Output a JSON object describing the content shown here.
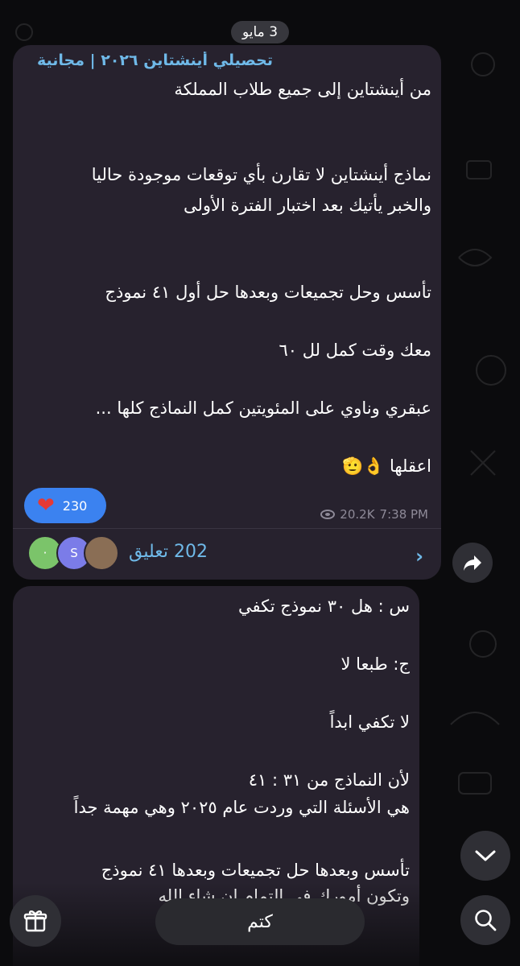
{
  "date_separator": "3 مايو",
  "post": {
    "channel": "تحصيلي أينشتاين ٢٠٢٦ | مجانية",
    "lines": [
      "من أينشتاين إلى جميع طلاب المملكة",
      "نماذج أينشتاين لا تقارن بأي توقعات موجودة حاليا",
      "والخبر يأتيك بعد اختبار الفترة الأولى",
      "تأسس وحل تجميعات وبعدها حل أول ٤١ نموذج",
      "معك وقت كمل لل ٦٠",
      "عبقري وناوي على المئويتين كمل النماذج كلها ...",
      "اعقلها 👌🫡"
    ],
    "reaction_icon": "heart-icon",
    "reaction_count": "230",
    "views": "20.2K",
    "time": "7:38 PM",
    "avatar_letters": [
      "·",
      "S",
      ""
    ],
    "comments_label": "202 تعليق"
  },
  "post2": {
    "lines": [
      "س : هل ٣٠ نموذج تكفي",
      "ج: طبعا لا",
      "لا تكفي ابداً",
      "لأن النماذج من ٣١ : ٤١",
      "هي الأسئلة التي وردت عام ٢٠٢٥ وهي مهمة جداً",
      "تأسس وبعدها حل تجميعات وبعدها ٤١ نموذج",
      "وتكون أمورك في التمام إن شاء الله"
    ]
  },
  "bottom_bar": {
    "mute_label": "كتم"
  },
  "colors": {
    "bubble": "#27222e",
    "accent": "#6fb9e8",
    "reaction": "#3b82f0"
  }
}
